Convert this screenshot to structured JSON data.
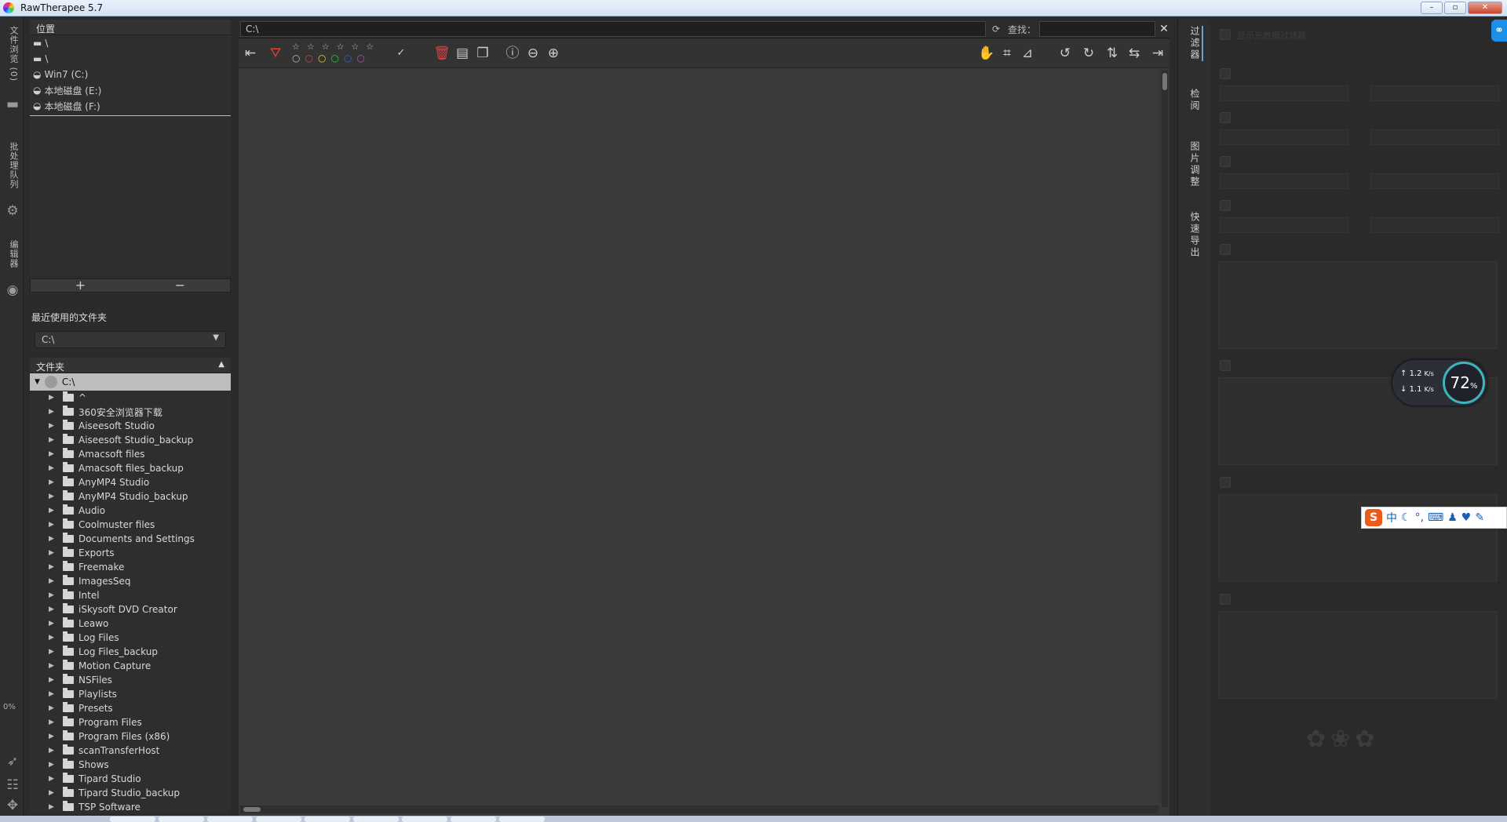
{
  "window": {
    "title": "RawTherapee 5.7",
    "min": "–",
    "max": "▫",
    "close": "✕"
  },
  "left_tabs": [
    {
      "label": "文件浏览 (0)"
    },
    {
      "label": "批处理队列"
    },
    {
      "label": "编辑器"
    }
  ],
  "left_status": {
    "percent": "0%"
  },
  "places": {
    "header": "位置",
    "items": [
      "\\",
      "\\",
      "Win7 (C:)",
      "本地磁盘 (E:)",
      "本地磁盘 (F:)"
    ],
    "add": "+",
    "remove": "−"
  },
  "recent": {
    "label": "最近使用的文件夹",
    "value": "C:\\"
  },
  "folders": {
    "header": "文件夹",
    "root": "C:\\",
    "items": [
      "^",
      "360安全浏览器下载",
      "Aiseesoft Studio",
      "Aiseesoft Studio_backup",
      "Amacsoft files",
      "Amacsoft files_backup",
      "AnyMP4 Studio",
      "AnyMP4 Studio_backup",
      "Audio",
      "Coolmuster files",
      "Documents and Settings",
      "Exports",
      "Freemake",
      "ImagesSeq",
      "Intel",
      "iSkysoft DVD Creator",
      "Leawo",
      "Log Files",
      "Log Files_backup",
      "Motion Capture",
      "NSFiles",
      "Playlists",
      "Presets",
      "Program Files",
      "Program Files (x86)",
      "scanTransferHost",
      "Shows",
      "Tipard Studio",
      "Tipard Studio_backup",
      "TSP Software"
    ]
  },
  "pathbar": {
    "path": "C:\\",
    "search_label": "查找："
  },
  "right_tabs": [
    {
      "label": "过滤器"
    },
    {
      "label": "检阅"
    },
    {
      "label": "图片调整"
    },
    {
      "label": "快速导出"
    }
  ],
  "filter_panel": {
    "first_option": "显示元数据过滤器"
  },
  "net_widget": {
    "up": "1.2",
    "down": "1.1",
    "unit": "K/s",
    "percent": "72",
    "percent_sign": "%"
  },
  "ime": {
    "logo": "S",
    "lang": "中"
  }
}
